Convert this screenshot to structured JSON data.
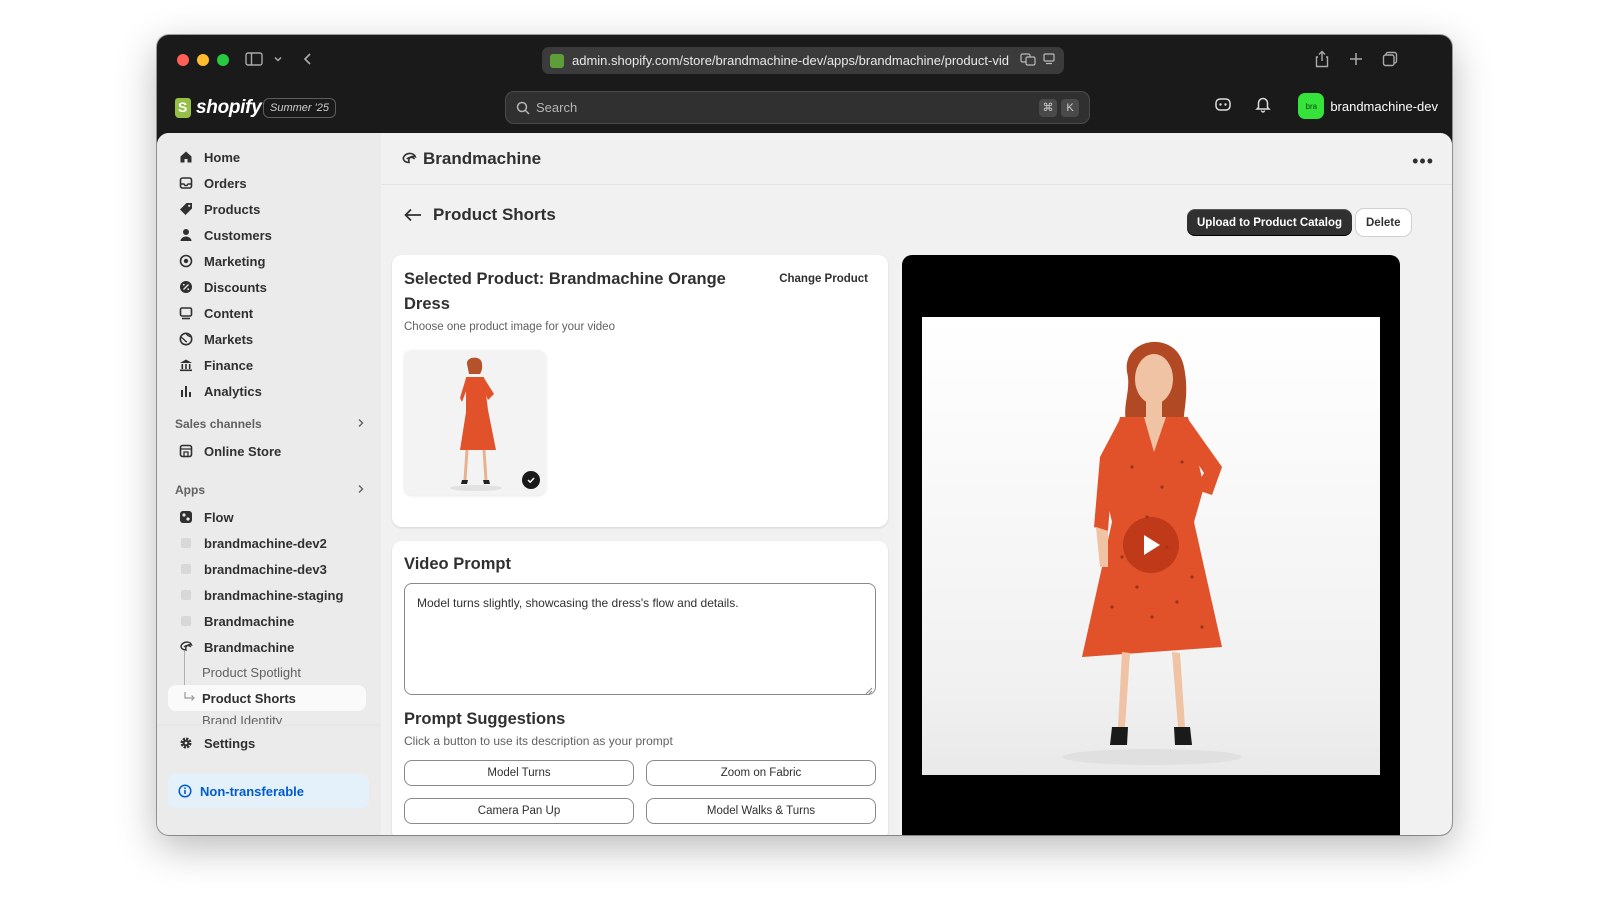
{
  "browser": {
    "url": "admin.shopify.com/store/brandmachine-dev/apps/brandmachine/product-vid"
  },
  "topbar": {
    "logo": "shopify",
    "edition": "Summer '25",
    "search_placeholder": "Search",
    "shortcut_keys": [
      "⌘",
      "K"
    ],
    "store_initials": "bra",
    "store_name": "brandmachine-dev"
  },
  "sidebar": {
    "main_items": [
      {
        "label": "Home",
        "icon": "home-icon"
      },
      {
        "label": "Orders",
        "icon": "inbox-icon"
      },
      {
        "label": "Products",
        "icon": "tag-icon"
      },
      {
        "label": "Customers",
        "icon": "person-icon"
      },
      {
        "label": "Marketing",
        "icon": "target-icon"
      },
      {
        "label": "Discounts",
        "icon": "discount-icon"
      },
      {
        "label": "Content",
        "icon": "content-icon"
      },
      {
        "label": "Markets",
        "icon": "globe-icon"
      },
      {
        "label": "Finance",
        "icon": "bank-icon"
      },
      {
        "label": "Analytics",
        "icon": "bar-chart-icon"
      }
    ],
    "sales_channels_label": "Sales channels",
    "online_store": "Online Store",
    "apps_label": "Apps",
    "apps": [
      {
        "label": "Flow"
      },
      {
        "label": "brandmachine-dev2"
      },
      {
        "label": "brandmachine-dev3"
      },
      {
        "label": "brandmachine-staging"
      },
      {
        "label": "Brandmachine"
      },
      {
        "label": "Brandmachine"
      }
    ],
    "app_subitems": [
      {
        "label": "Product Spotlight"
      },
      {
        "label": "Product Shorts"
      },
      {
        "label": "Brand Identity"
      }
    ],
    "settings": "Settings",
    "non_transferable": "Non-transferable"
  },
  "app_header": {
    "title": "Brandmachine"
  },
  "page": {
    "title": "Product Shorts",
    "upload_button": "Upload to Product Catalog",
    "delete_button": "Delete"
  },
  "product_card": {
    "title": "Selected Product: Brandmachine Orange Dress",
    "change_button": "Change Product",
    "hint": "Choose one product image for your video"
  },
  "prompt_card": {
    "title": "Video Prompt",
    "prompt_value": "Model turns slightly, showcasing the dress's flow and details.",
    "suggestions_title": "Prompt Suggestions",
    "suggestions_hint": "Click a button to use its description as your prompt",
    "suggestions": [
      "Model Turns",
      "Zoom on Fabric",
      "Camera Pan Up",
      "Model Walks & Turns"
    ]
  },
  "colors": {
    "chrome": "#1a1a1a",
    "accent_blue": "#005bd3",
    "store_avatar": "#35e33a",
    "dress_orange": "#e2522a"
  }
}
